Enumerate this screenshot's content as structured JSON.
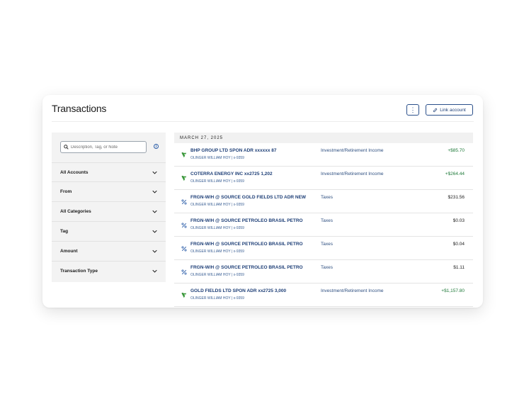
{
  "header": {
    "title": "Transactions",
    "more_label": "⋮",
    "link_account_label": "Link account"
  },
  "sidebar": {
    "search_placeholder": "Description, Tag, or Note",
    "filters": [
      {
        "label": "All Accounts"
      },
      {
        "label": "From"
      },
      {
        "label": "All Categories"
      },
      {
        "label": "Tag"
      },
      {
        "label": "Amount"
      },
      {
        "label": "Transaction Type"
      }
    ]
  },
  "transactions": {
    "date": "MARCH 27, 2025",
    "rows": [
      {
        "icon": "dividend-icon",
        "description": "BHP GROUP LTD SPON ADR xxxxxx 87",
        "account": "OLINGER WILLIAM HOY | x-9359",
        "category": "Investment/Retirement Income",
        "amount": "+$85.70",
        "positive": true
      },
      {
        "icon": "dividend-icon",
        "description": "COTERRA ENERGY INC xx2725 1,202",
        "account": "OLINGER WILLIAM HOY | x-9359",
        "category": "Investment/Retirement Income",
        "amount": "+$264.44",
        "positive": true
      },
      {
        "icon": "tax-icon",
        "description": "FRGN-W/H @ SOURCE GOLD FIELDS LTD ADR NEW",
        "account": "OLINGER WILLIAM HOY | x-9359",
        "category": "Taxes",
        "amount": "$231.56",
        "positive": false
      },
      {
        "icon": "tax-icon",
        "description": "FRGN-W/H @ SOURCE PETROLEO BRASIL PETRO",
        "account": "OLINGER WILLIAM HOY | x-9359",
        "category": "Taxes",
        "amount": "$0.03",
        "positive": false
      },
      {
        "icon": "tax-icon",
        "description": "FRGN-W/H @ SOURCE PETROLEO BRASIL PETRO",
        "account": "OLINGER WILLIAM HOY | x-9359",
        "category": "Taxes",
        "amount": "$0.04",
        "positive": false
      },
      {
        "icon": "tax-icon",
        "description": "FRGN-W/H @ SOURCE PETROLEO BRASIL PETRO",
        "account": "OLINGER WILLIAM HOY | x-9359",
        "category": "Taxes",
        "amount": "$1.11",
        "positive": false
      },
      {
        "icon": "dividend-icon",
        "description": "GOLD FIELDS LTD SPON ADR xx2725 3,000",
        "account": "OLINGER WILLIAM HOY | x-9359",
        "category": "Investment/Retirement Income",
        "amount": "+$1,157.80",
        "positive": true
      }
    ]
  },
  "colors": {
    "accent": "#1e3f77",
    "positive": "#1f7a3a",
    "icon_green": "#3c9a3c",
    "sidebar_bg": "#f3f3f3"
  }
}
